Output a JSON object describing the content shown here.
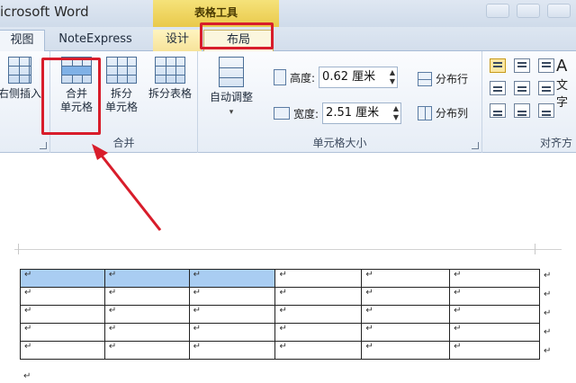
{
  "window": {
    "app_title": "icrosoft Word"
  },
  "context_tab_group": {
    "label": "表格工具"
  },
  "tabs": {
    "view": "视图",
    "noteexpress": "NoteExpress",
    "design": "设计",
    "layout": "布局"
  },
  "ribbon": {
    "insert_right_label": "右侧插入",
    "merge_group": {
      "caption": "合并",
      "merge_cells_line1": "合并",
      "merge_cells_line2": "单元格",
      "split_cells_line1": "拆分",
      "split_cells_line2": "单元格",
      "split_table": "拆分表格"
    },
    "cell_size_group": {
      "caption": "单元格大小",
      "autofit_label": "自动调整",
      "height_label": "高度:",
      "height_value": "0.62 厘米",
      "width_label": "宽度:",
      "width_value": "2.51 厘米",
      "distribute_rows": "分布行",
      "distribute_columns": "分布列"
    },
    "alignment_group": {
      "caption": "对齐方",
      "text_direction": "文字"
    }
  },
  "document": {
    "table": {
      "rows": 5,
      "cols": 6,
      "cell_mark": "↵",
      "selected_cells": [
        [
          0,
          0
        ],
        [
          0,
          1
        ],
        [
          0,
          2
        ]
      ]
    },
    "trailing_mark": "↵"
  }
}
